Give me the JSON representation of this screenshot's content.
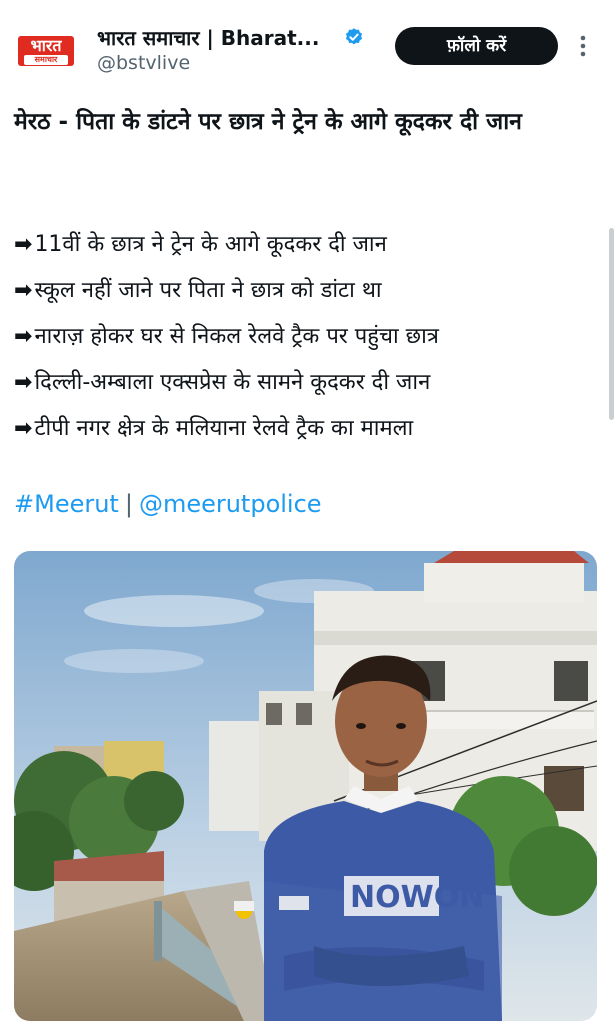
{
  "post": {
    "author": {
      "avatar_text_top": "भारत",
      "avatar_text_bottom": "समाचार",
      "display_name": "भारत समाचार | Bharat...",
      "handle": "@bstvlive",
      "verified": true
    },
    "follow_label": "फ़ॉलो करें",
    "title": "मेरठ - पिता के डांटने पर छात्र ने ट्रेन के आगे कूदकर दी जान",
    "bullet_arrow": "➡",
    "bullets": [
      "11वीं के छात्र ने ट्रेन के आगे कूदकर दी जान",
      "स्कूल नहीं जाने पर पिता ने छात्र को डांटा था",
      "नाराज़ होकर घर से निकल रेलवे ट्रैक पर पहुंचा छात्र",
      "दिल्ली-अम्बाला एक्सप्रेस के सामने कूदकर दी जान",
      "टीपी नगर क्षेत्र के मलियाना रेलवे ट्रैक का मामला"
    ],
    "hashtag": "#Meerut",
    "separator": "|",
    "mention": "@meerutpolice",
    "photo_sweatshirt_text": "NOWON"
  },
  "colors": {
    "link": "#1d9bf0",
    "follow_button_bg": "#0f1419",
    "avatar_red": "#e02b20",
    "verified_blue": "#1d9bf0",
    "sweatshirt_blue": "#3d5aa6"
  }
}
